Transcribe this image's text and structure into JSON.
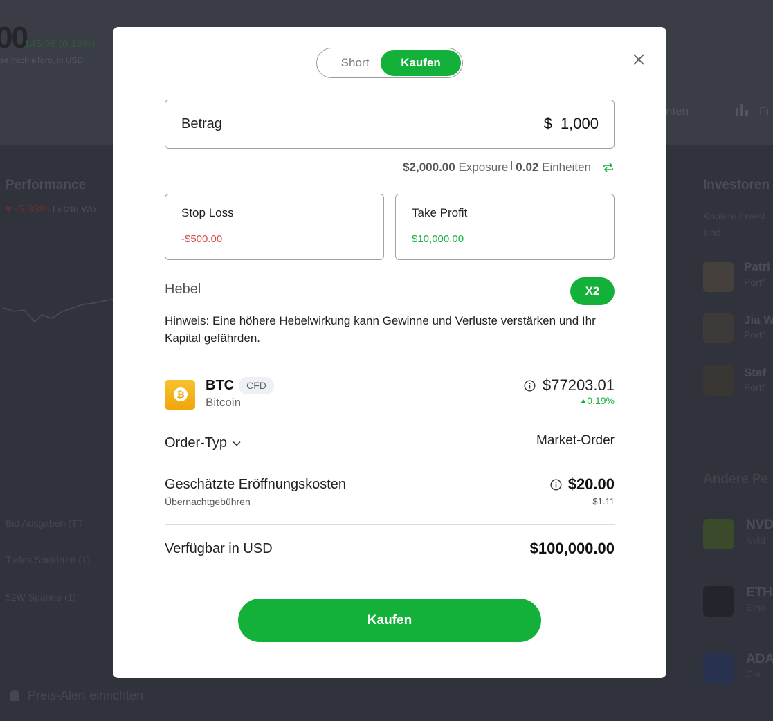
{
  "background": {
    "price": "00",
    "price_change": "145.98 (0.19%)",
    "price_note": "se nach eToro, in USD",
    "tab_partial_1": "nten",
    "tab_partial_2": "Fi",
    "performance_title": "Performance",
    "performance_value": "▾ -5.33%",
    "performance_period": "Letzte Wo",
    "left_rows": [
      "Bid Ausgaben (TT",
      "Tiefes Spektrum (1)",
      "52W Spanne (1)"
    ],
    "price_alert": "Preis-Alert einrichten",
    "investors_title": "Investoren",
    "investors_sub": "Kopiere Invest sind.",
    "people": [
      {
        "name": "Patri",
        "sub": "Portf"
      },
      {
        "name": "Jia W",
        "sub": "Portf"
      },
      {
        "name": "Stef",
        "sub": "Portf"
      }
    ],
    "other_title": "Andere Pe",
    "assets": [
      {
        "name": "NVD",
        "sub": "Nvid",
        "color": "#3a4a2a"
      },
      {
        "name": "ETH",
        "sub": "Ethe",
        "color": "#22252c"
      },
      {
        "name": "ADA",
        "sub": "Car",
        "color": "#283150"
      }
    ]
  },
  "modal": {
    "toggle": {
      "short_label": "Short",
      "buy_label": "Kaufen",
      "selected": "Kaufen"
    },
    "amount": {
      "label": "Betrag",
      "currency": "$",
      "value": "1,000"
    },
    "exposure": {
      "exposure_value": "$2,000.00",
      "exposure_label": "Exposure",
      "units_value": "0.02",
      "units_label": "Einheiten"
    },
    "stop_loss": {
      "label": "Stop Loss",
      "value": "-$500.00"
    },
    "take_profit": {
      "label": "Take Profit",
      "value": "$10,000.00"
    },
    "leverage": {
      "label": "Hebel",
      "value": "X2"
    },
    "hint": "Hinweis: Eine höhere Hebelwirkung kann Gewinne und Verluste verstärken und Ihr Kapital gefährden.",
    "asset": {
      "symbol": "BTC",
      "badge": "CFD",
      "name": "Bitcoin",
      "price": "$77203.01",
      "change": "0.19%",
      "logo_glyph": "₿"
    },
    "order_type": {
      "label": "Order-Typ",
      "value": "Market-Order"
    },
    "costs": {
      "label": "Geschätzte Eröffnungskosten",
      "value": "$20.00",
      "sub_label": "Übernachtgebühren",
      "sub_value": "$1.11"
    },
    "available": {
      "label": "Verfügbar in USD",
      "value": "$100,000.00"
    },
    "buy_button": "Kaufen"
  },
  "colors": {
    "accent_green": "#13b13a",
    "loss_red": "#d94a4a",
    "overlay": "#30333b"
  }
}
